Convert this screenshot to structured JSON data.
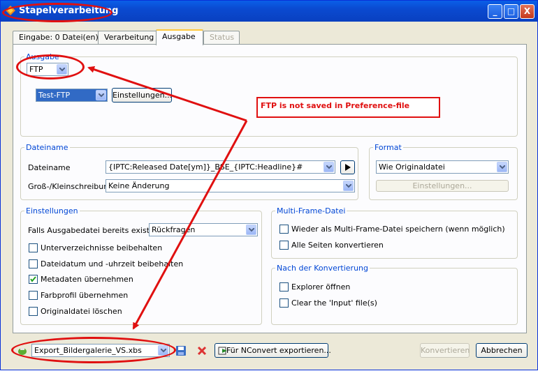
{
  "window": {
    "title": "Stapelverarbeitung",
    "controls": [
      "_",
      "□",
      "X"
    ]
  },
  "tabs": [
    {
      "label": "Eingabe: 0 Datei(en)",
      "state": "normal"
    },
    {
      "label": "Verarbeitung",
      "state": "normal"
    },
    {
      "label": "Ausgabe",
      "state": "active"
    },
    {
      "label": "Status",
      "state": "disabled"
    }
  ],
  "ausgabe": {
    "group_label": "Ausgabe",
    "type_value": "FTP",
    "ftp_profile_value": "Test-FTP",
    "settings_button": "Einstellungen..."
  },
  "annotation": {
    "note": "FTP is not saved in Preference-file"
  },
  "dateiname": {
    "group_label": "Dateiname",
    "name_label": "Dateiname",
    "name_value": "{IPTC:Released Date[ym]}_BSE_{IPTC:Headline}#",
    "case_label": "Groß-/Kleinschreibung",
    "case_value": "Keine Änderung"
  },
  "format": {
    "group_label": "Format",
    "value": "Wie Originaldatei",
    "settings_button": "Einstellungen..."
  },
  "einstellungen": {
    "group_label": "Einstellungen",
    "exists_label": "Falls Ausgabedatei bereits existiert",
    "exists_value": "Rückfragen",
    "options": [
      {
        "label": "Unterverzeichnisse beibehalten",
        "checked": false
      },
      {
        "label": "Dateidatum und -uhrzeit beibehalten",
        "checked": false
      },
      {
        "label": "Metadaten übernehmen",
        "checked": true
      },
      {
        "label": "Farbprofil übernehmen",
        "checked": false
      },
      {
        "label": "Originaldatei löschen",
        "checked": false
      }
    ]
  },
  "multiframe": {
    "group_label": "Multi-Frame-Datei",
    "options": [
      {
        "label": "Wieder als Multi-Frame-Datei speichern (wenn möglich)",
        "checked": false
      },
      {
        "label": "Alle Seiten konvertieren",
        "checked": false
      }
    ]
  },
  "nachkonv": {
    "group_label": "Nach der Konvertierung",
    "options": [
      {
        "label": "Explorer öffnen",
        "checked": false
      },
      {
        "label": "Clear the 'Input' file(s)",
        "checked": false
      }
    ]
  },
  "footer": {
    "script_value": "Export_Bildergalerie_VS.xbs",
    "nconvert_button": "Für NConvert exportieren...",
    "convert_button": "Konvertieren",
    "cancel_button": "Abbrechen"
  },
  "colors": {
    "accent_red": "#e01010",
    "title_blue": "#0a4ad0",
    "group_label_blue": "#0046d5"
  }
}
